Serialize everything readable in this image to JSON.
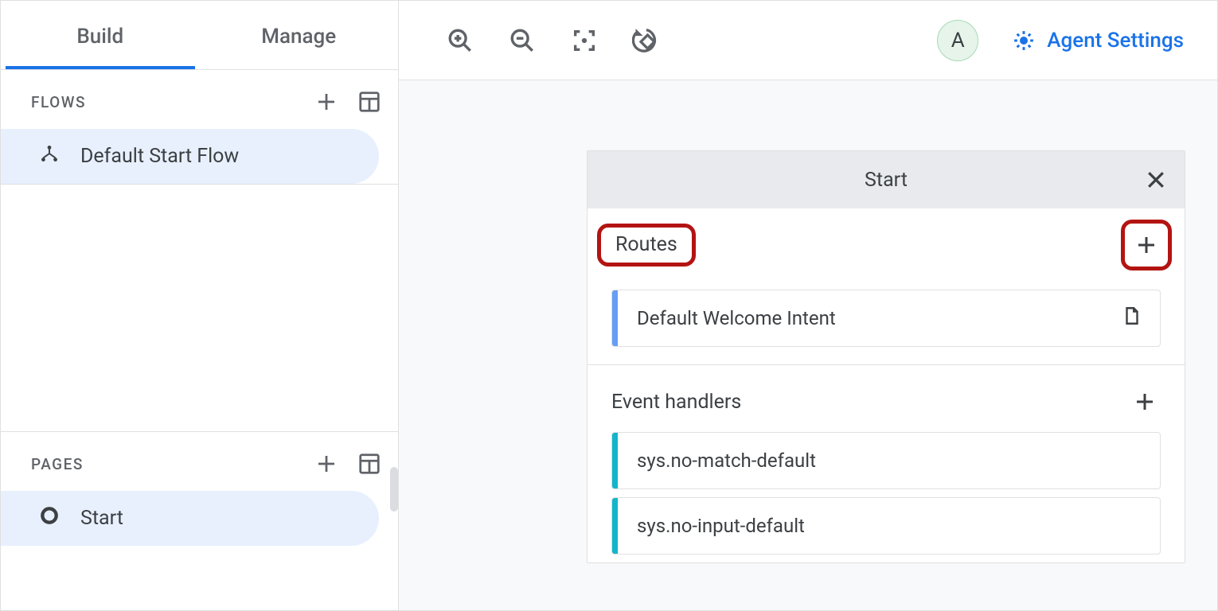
{
  "sidebar": {
    "tabs": {
      "build": "Build",
      "manage": "Manage"
    },
    "flows": {
      "title": "FLOWS",
      "items": [
        {
          "label": "Default Start Flow"
        }
      ]
    },
    "pages": {
      "title": "PAGES",
      "items": [
        {
          "label": "Start"
        }
      ]
    }
  },
  "toolbar": {
    "avatar_initial": "A",
    "agent_settings_label": "Agent Settings"
  },
  "panel": {
    "title": "Start",
    "routes": {
      "heading": "Routes",
      "items": [
        {
          "label": "Default Welcome Intent"
        }
      ]
    },
    "event_handlers": {
      "heading": "Event handlers",
      "items": [
        {
          "label": "sys.no-match-default"
        },
        {
          "label": "sys.no-input-default"
        }
      ]
    }
  }
}
